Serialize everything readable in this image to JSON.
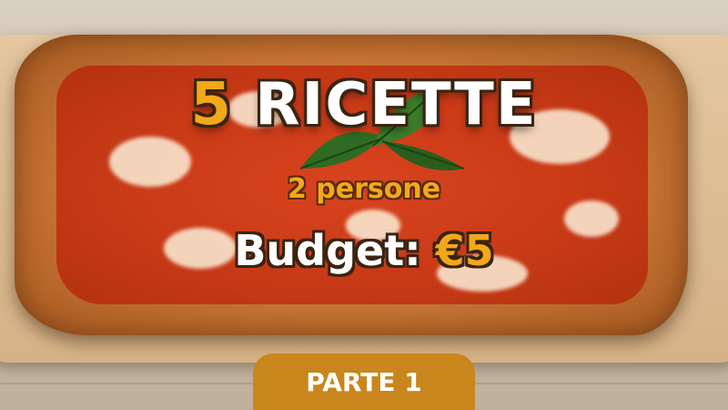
{
  "title": {
    "number": "5",
    "word": "RICETTE"
  },
  "subtitle": "2 persone",
  "budget": {
    "label": "Budget:",
    "amount": "€5"
  },
  "badge": "PARTE 1",
  "colors": {
    "accent": "#f2a81b",
    "badge_bg": "#c8861c",
    "outline": "#3a2412",
    "text": "#ffffff"
  }
}
